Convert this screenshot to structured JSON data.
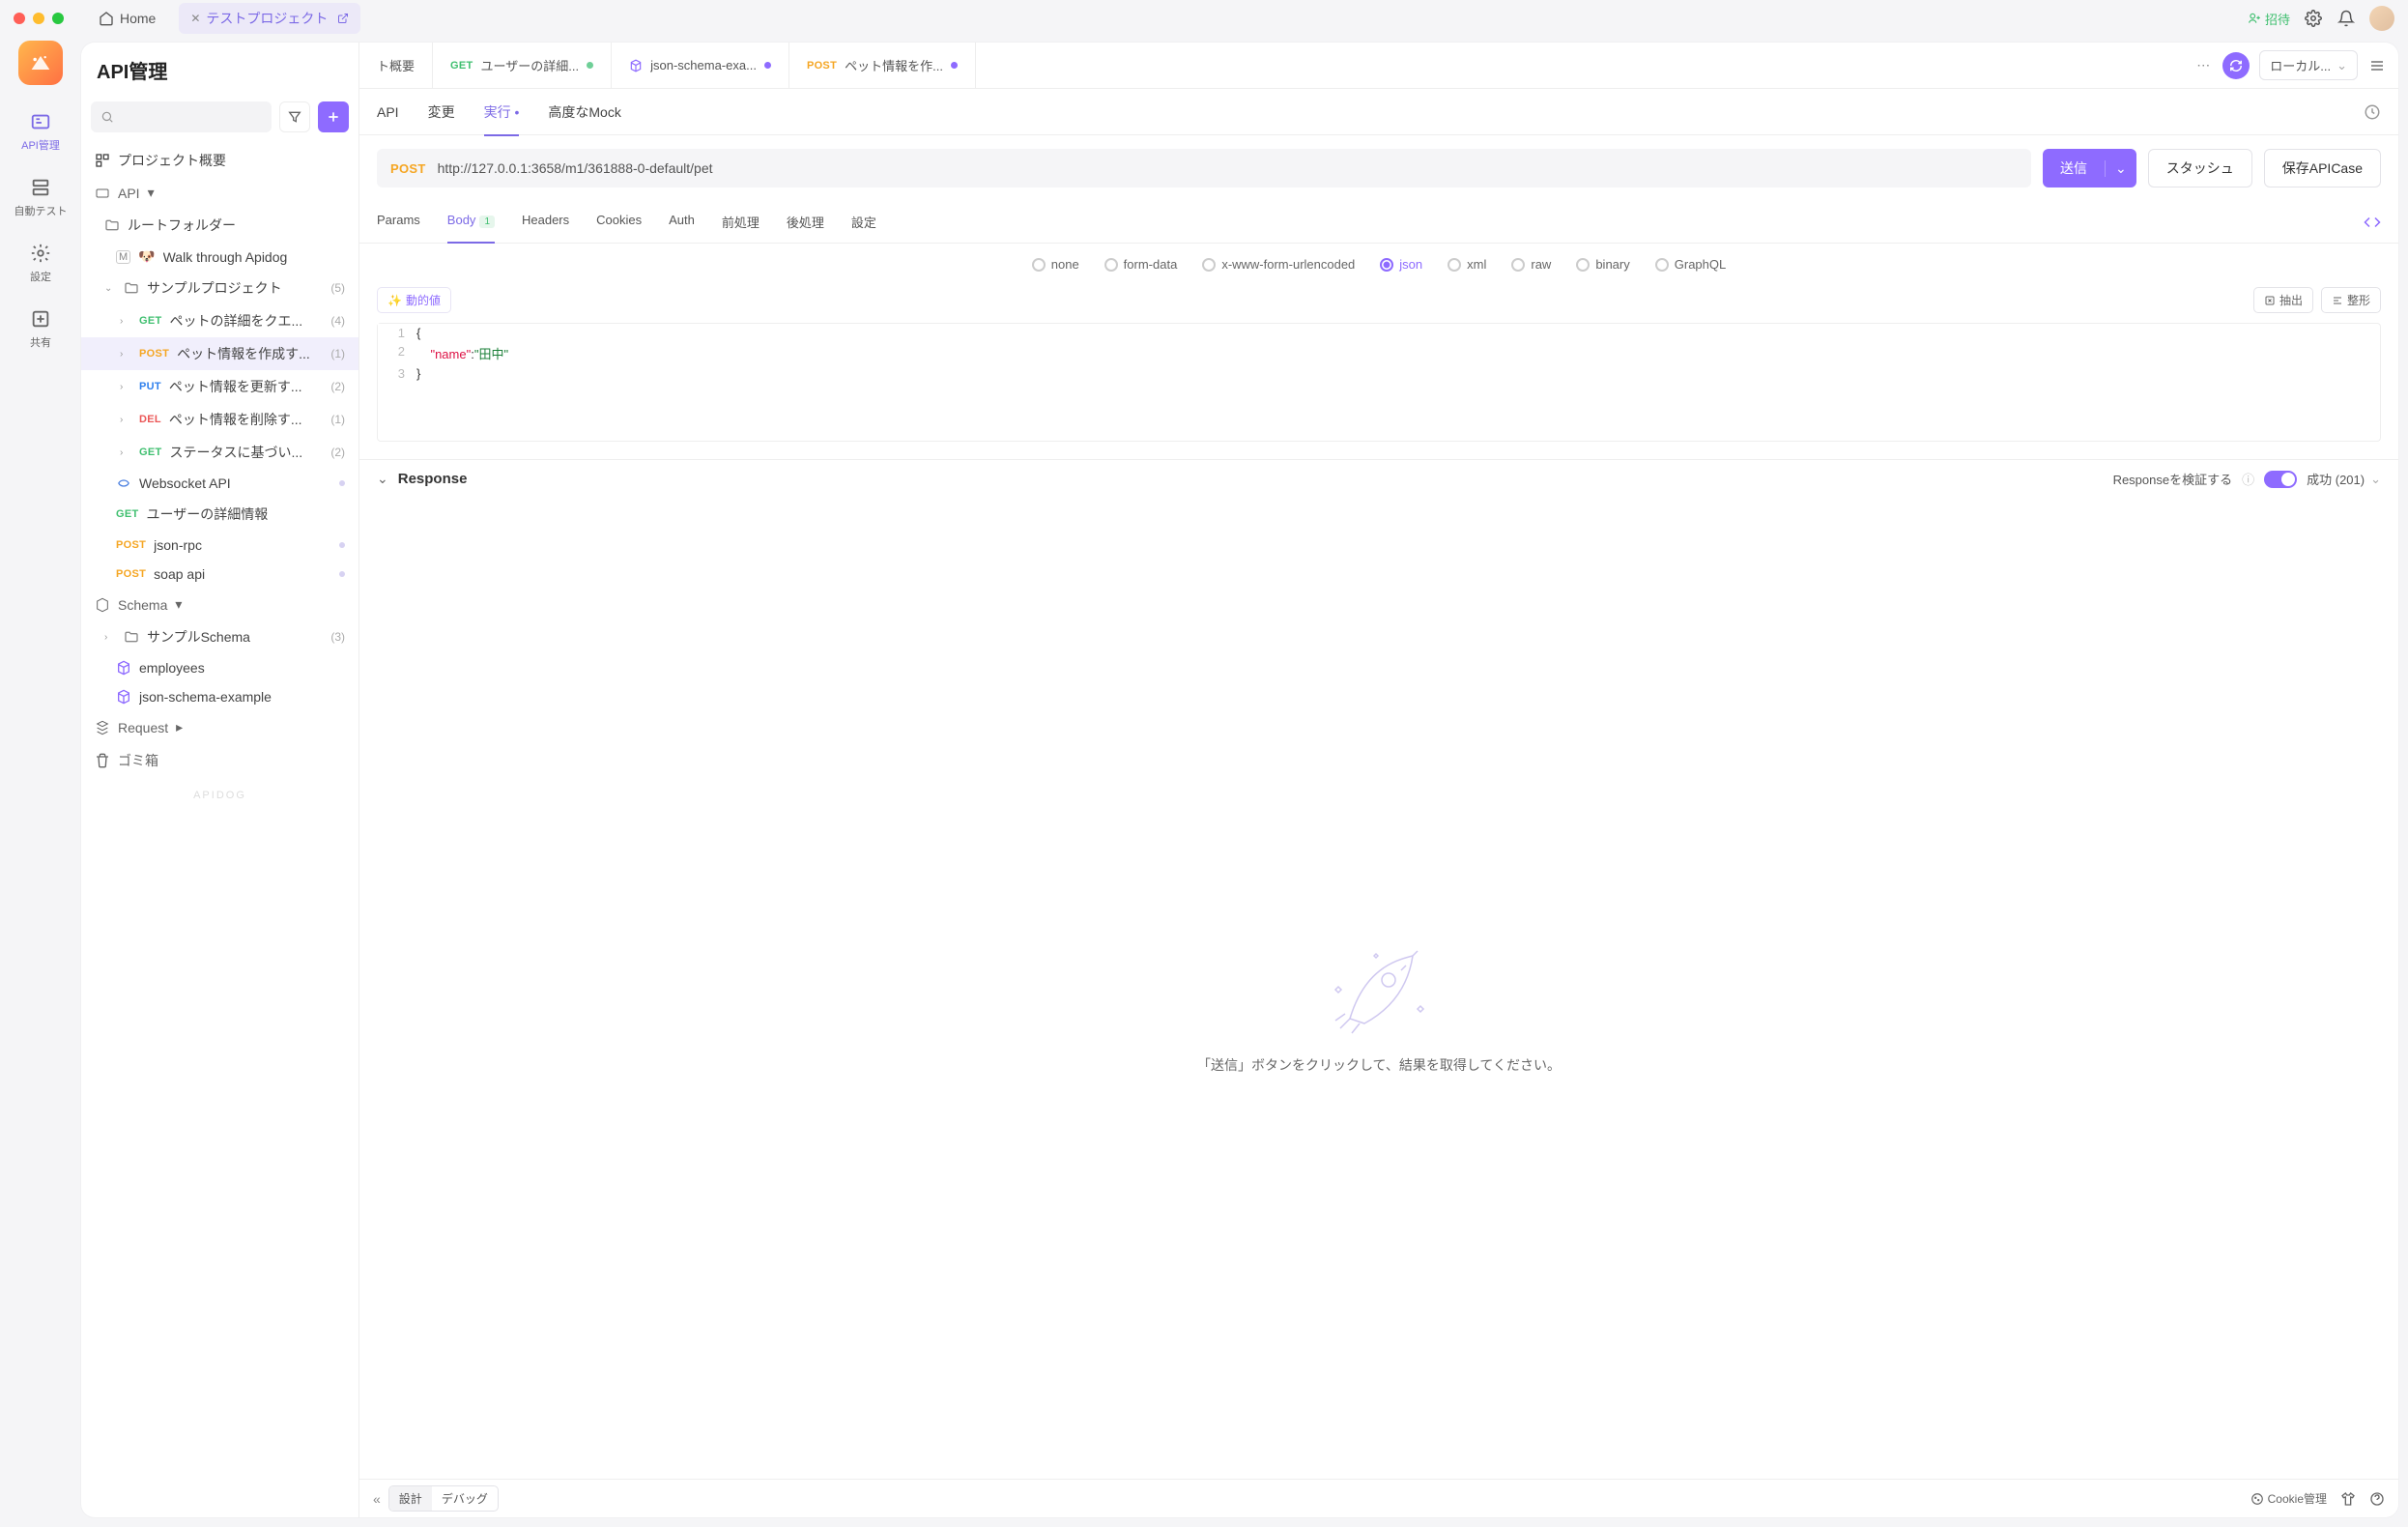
{
  "titlebar": {
    "home_label": "Home",
    "project_label": "テストプロジェクト",
    "invite_label": "招待"
  },
  "rail": {
    "items": [
      {
        "label": "API管理"
      },
      {
        "label": "自動テスト"
      },
      {
        "label": "設定"
      },
      {
        "label": "共有"
      }
    ]
  },
  "sidebar": {
    "title": "API管理",
    "overview_label": "プロジェクト概要",
    "api_section_label": "API",
    "root_folder_label": "ルートフォルダー",
    "walk_label": "Walk through Apidog",
    "sample_project_label": "サンプルプロジェクト",
    "sample_project_count": "(5)",
    "endpoints": [
      {
        "method": "GET",
        "cls": "m-get",
        "label": "ペットの詳細をクエ...",
        "count": "(4)"
      },
      {
        "method": "POST",
        "cls": "m-post",
        "label": "ペット情報を作成す...",
        "count": "(1)"
      },
      {
        "method": "PUT",
        "cls": "m-put",
        "label": "ペット情報を更新す...",
        "count": "(2)"
      },
      {
        "method": "DEL",
        "cls": "m-del",
        "label": "ペット情報を削除す...",
        "count": "(1)"
      },
      {
        "method": "GET",
        "cls": "m-get",
        "label": "ステータスに基づい...",
        "count": "(2)"
      }
    ],
    "websocket_label": "Websocket API",
    "user_detail_label": "ユーザーの詳細情報",
    "jsonrpc_label": "json-rpc",
    "soap_label": "soap api",
    "schema_section_label": "Schema",
    "sample_schema_label": "サンプルSchema",
    "sample_schema_count": "(3)",
    "schema_items": [
      {
        "label": "employees"
      },
      {
        "label": "json-schema-example"
      }
    ],
    "request_section_label": "Request",
    "trash_label": "ゴミ箱",
    "watermark": "APIDOG"
  },
  "tabs": {
    "items": [
      {
        "text": "ト概要"
      },
      {
        "method": "GET",
        "mcls": "m-get",
        "text": "ユーザーの詳細...",
        "dirty": "green"
      },
      {
        "icon": "cube",
        "text": "json-schema-exa...",
        "dirty": "blue"
      },
      {
        "method": "POST",
        "mcls": "m-post",
        "text": "ペット情報を作...",
        "dirty": "blue",
        "active": true
      }
    ],
    "env_label": "ローカル..."
  },
  "subtabs": {
    "items": [
      "API",
      "変更",
      "実行",
      "高度なMock"
    ],
    "active_index": 2
  },
  "request": {
    "method": "POST",
    "url": "http://127.0.0.1:3658/m1/361888-0-default/pet",
    "send_label": "送信",
    "stash_label": "スタッシュ",
    "save_label": "保存APICase"
  },
  "inner_tabs": {
    "items": [
      "Params",
      "Body",
      "Headers",
      "Cookies",
      "Auth",
      "前処理",
      "後処理",
      "設定"
    ],
    "body_badge": "1"
  },
  "body_types": [
    "none",
    "form-data",
    "x-www-form-urlencoded",
    "json",
    "xml",
    "raw",
    "binary",
    "GraphQL"
  ],
  "body_type_selected_index": 3,
  "editor_toolbar": {
    "dynamic_label": "動的値",
    "extract_label": "抽出",
    "format_label": "整形"
  },
  "code": {
    "l1": "{",
    "l2_indent": "    ",
    "l2_key": "\"name\"",
    "l2_sep": ":",
    "l2_val": "\"田中\"",
    "l3": "}"
  },
  "response": {
    "title": "Response",
    "verify_label": "Responseを検証する",
    "status_label": "成功 (201)",
    "empty_text": "「送信」ボタンをクリックして、結果を取得してください。"
  },
  "footer": {
    "design_label": "設計",
    "debug_label": "デバッグ",
    "cookie_label": "Cookie管理"
  }
}
